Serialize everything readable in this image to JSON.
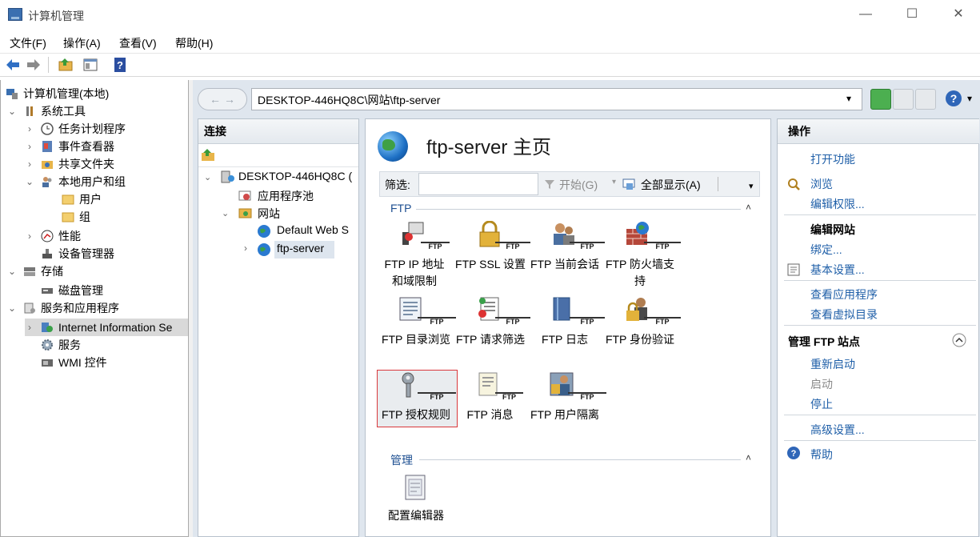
{
  "window": {
    "title": "计算机管理",
    "controls": [
      "—",
      "☐",
      "✕"
    ]
  },
  "menu": [
    "文件(F)",
    "操作(A)",
    "查看(V)",
    "帮助(H)"
  ],
  "tree": [
    {
      "label": "计算机管理(本地)"
    },
    {
      "label": "系统工具"
    },
    {
      "label": "任务计划程序"
    },
    {
      "label": "事件查看器"
    },
    {
      "label": "共享文件夹"
    },
    {
      "label": "本地用户和组"
    },
    {
      "label": "用户"
    },
    {
      "label": "组"
    },
    {
      "label": "性能"
    },
    {
      "label": "设备管理器"
    },
    {
      "label": "存储"
    },
    {
      "label": "磁盘管理"
    },
    {
      "label": "服务和应用程序"
    },
    {
      "label": "Internet Information Se"
    },
    {
      "label": "服务"
    },
    {
      "label": "WMI 控件"
    }
  ],
  "address": {
    "path": "DESKTOP-446HQ8C\\网站\\ftp-server",
    "back": "←",
    "forward": "→"
  },
  "connections": {
    "header": "连接",
    "nodes": [
      "DESKTOP-446HQ8C (",
      "应用程序池",
      "网站",
      "Default Web S",
      "ftp-server"
    ]
  },
  "main": {
    "title": "ftp-server 主页",
    "filter_label": "筛选:",
    "start_label": "开始(G)",
    "show_all_label": "全部显示(A)",
    "group_ftp": "FTP",
    "group_manage": "管理",
    "features": [
      {
        "line1": "FTP IP 地址",
        "line2": "和域限制"
      },
      {
        "line1": "FTP SSL 设置",
        "line2": ""
      },
      {
        "line1": "FTP 当前会话",
        "line2": ""
      },
      {
        "line1": "FTP 防火墙支",
        "line2": "持"
      },
      {
        "line1": "FTP 目录浏览",
        "line2": ""
      },
      {
        "line1": "FTP 请求筛选",
        "line2": ""
      },
      {
        "line1": "FTP 日志",
        "line2": ""
      },
      {
        "line1": "FTP 身份验证",
        "line2": ""
      },
      {
        "line1": "FTP 授权规则",
        "line2": ""
      },
      {
        "line1": "FTP 消息",
        "line2": ""
      },
      {
        "line1": "FTP 用户隔离",
        "line2": ""
      }
    ],
    "manage_features": [
      {
        "line1": "配置编辑器"
      }
    ],
    "ftp_tag": "FTP"
  },
  "actions": {
    "header": "操作",
    "items": [
      "打开功能",
      "浏览",
      "编辑权限...",
      "编辑网站",
      "绑定...",
      "基本设置...",
      "查看应用程序",
      "查看虚拟目录",
      "管理 FTP 站点",
      "重新启动",
      "启动",
      "停止",
      "高级设置...",
      "帮助"
    ]
  },
  "colors": {
    "link": "#1f5fa8",
    "selection_border": "#d9383c",
    "iis_bg": "#dfe6ee"
  }
}
